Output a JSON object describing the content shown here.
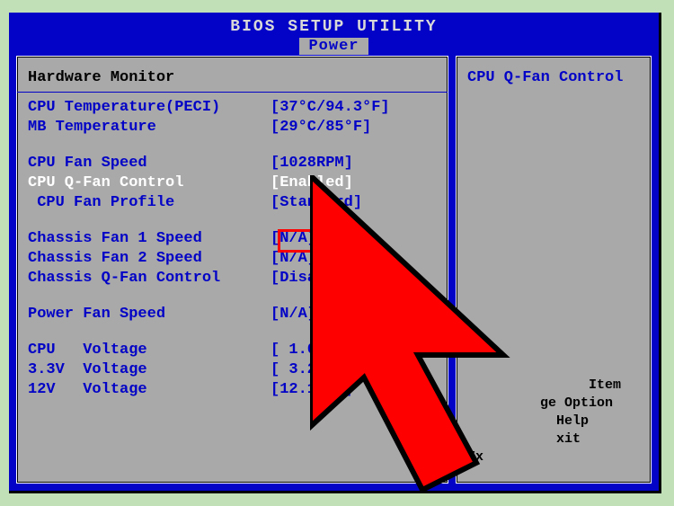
{
  "title": "BIOS SETUP UTILITY",
  "tab": "Power",
  "left": {
    "heading": "Hardware Monitor",
    "rows": [
      {
        "label": "CPU Temperature(PECI)",
        "value": "[37°C/94.3°F]",
        "selected": false
      },
      {
        "label": "MB Temperature",
        "value": "[29°C/85°F]",
        "selected": false
      },
      {
        "gap": true
      },
      {
        "label": "CPU Fan Speed",
        "value": "[1028RPM]",
        "selected": false
      },
      {
        "label": "CPU Q-Fan Control",
        "value": "[Enabled]",
        "selected": true
      },
      {
        "label": " CPU Fan Profile",
        "value": "[Standard]",
        "selected": false
      },
      {
        "gap": true
      },
      {
        "label": "Chassis Fan 1 Speed",
        "value": "[N/A]",
        "selected": false
      },
      {
        "label": "Chassis Fan 2 Speed",
        "value": "[N/A]",
        "selected": false
      },
      {
        "label": "Chassis Q-Fan Control",
        "value": "[Disabled]",
        "selected": false
      },
      {
        "gap": true
      },
      {
        "label": "Power Fan Speed",
        "value": "[N/A]",
        "selected": false
      },
      {
        "gap": true
      },
      {
        "label": "CPU   Voltage",
        "value": "[ 1.096V]",
        "selected": false
      },
      {
        "label": "3.3V  Voltage",
        "value": "[ 3.296V]",
        "selected": false
      },
      {
        "label": "12V   Voltage",
        "value": "[12.152V]",
        "selected": false
      }
    ]
  },
  "right": {
    "heading": "CPU Q-Fan Control",
    "help": "               Item\n         ge Option\n           Help\n           xit\nEx"
  },
  "cursor": {
    "color_fill": "#ff0000",
    "color_stroke": "#000"
  }
}
